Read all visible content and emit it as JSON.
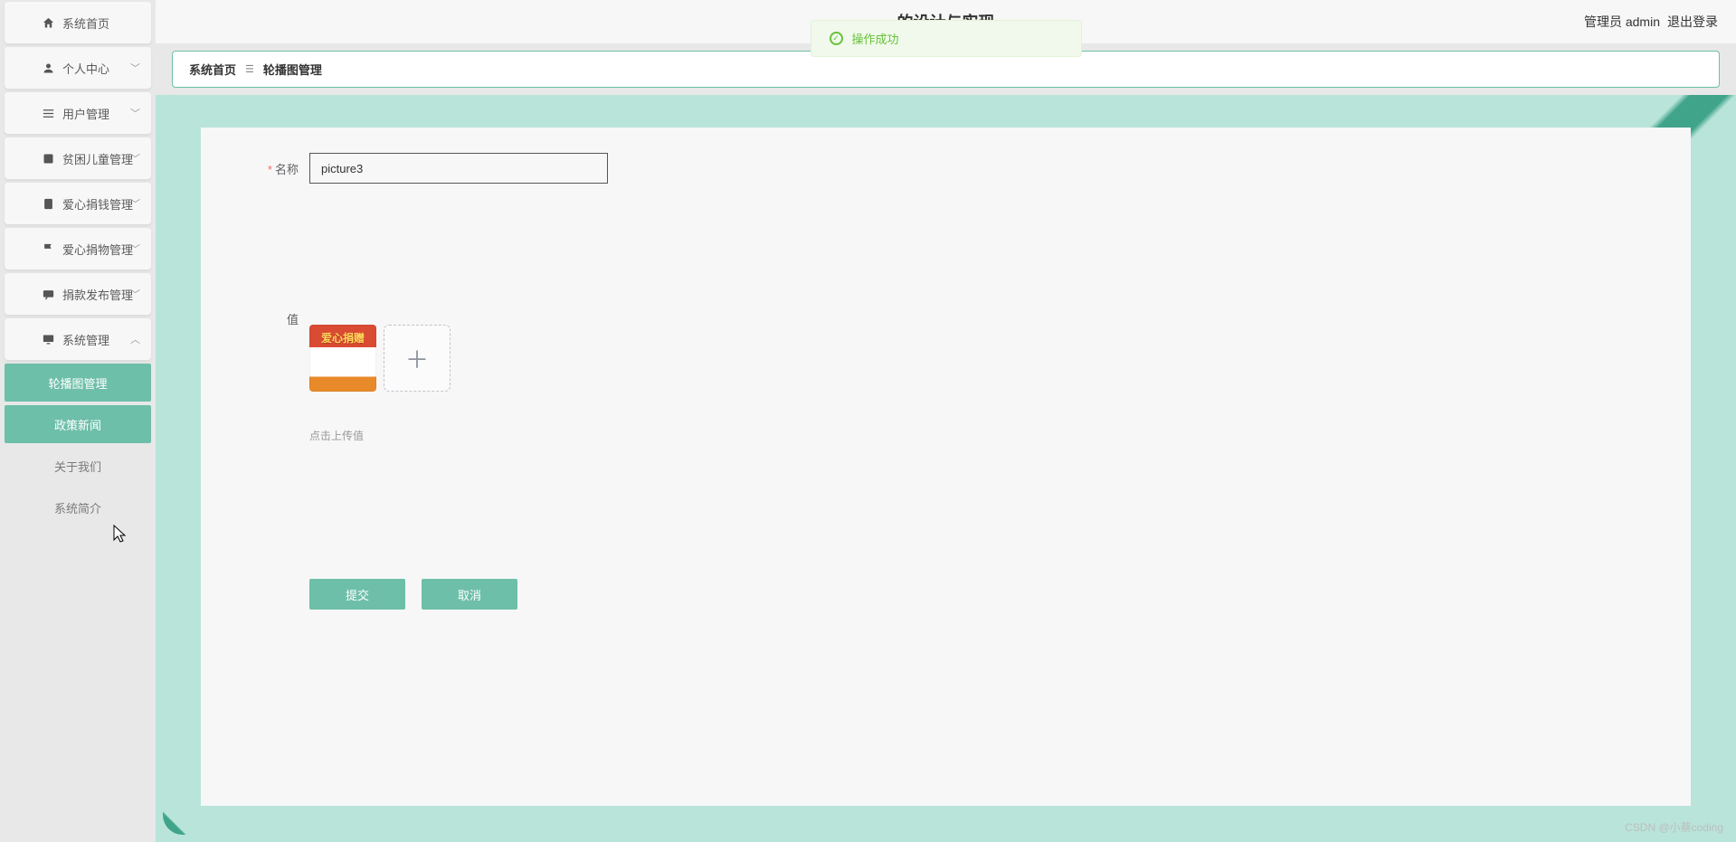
{
  "header": {
    "title_fragment": "的设计与实现",
    "admin_label": "管理员 admin",
    "logout_label": "退出登录"
  },
  "toast": {
    "text": "操作成功"
  },
  "sidebar": {
    "home": "系统首页",
    "personal": "个人中心",
    "user_mgmt": "用户管理",
    "poor_children": "贫困儿童管理",
    "love_money": "爱心捐钱管理",
    "love_goods": "爱心捐物管理",
    "donate_pub": "捐款发布管理",
    "sys_mgmt": "系统管理",
    "sub": {
      "carousel": "轮播图管理",
      "policy_news": "政策新闻",
      "about_us": "关于我们",
      "sys_intro": "系统简介"
    }
  },
  "breadcrumb": {
    "home": "系统首页",
    "current": "轮播图管理"
  },
  "form": {
    "name_label": "名称",
    "name_value": "picture3",
    "value_label": "值",
    "upload_hint": "点击上传值",
    "submit": "提交",
    "cancel": "取消",
    "thumb_caption": "爱心捐赠"
  },
  "watermark": "CSDN @小蔡coding"
}
